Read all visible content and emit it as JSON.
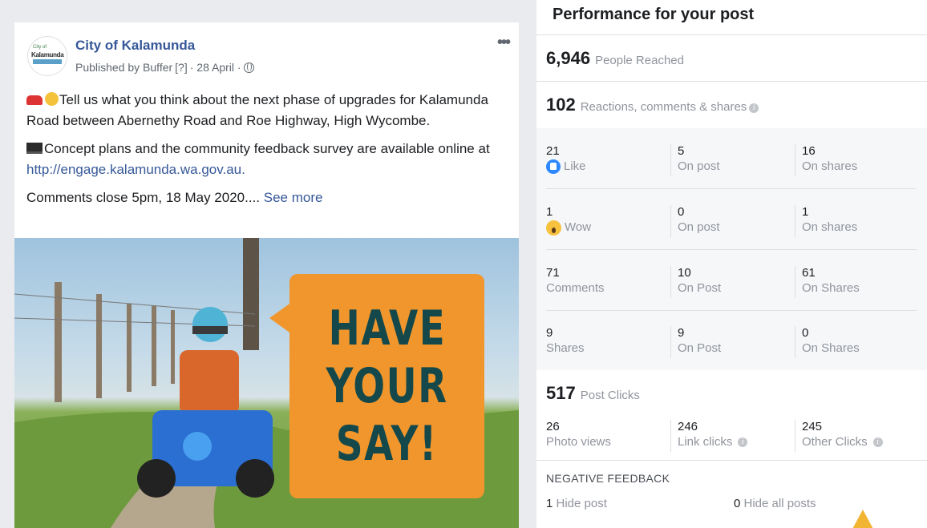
{
  "post": {
    "page_name": "City of Kalamunda",
    "avatar_text": {
      "top": "City of",
      "main": "Kalamunda",
      "band": ""
    },
    "published_by": "Published by Buffer",
    "bracket": "[?]",
    "date": "· 28 April ·",
    "more": "•••",
    "paragraph1": "Tell us what you think about the next phase of upgrades for Kalamunda Road between Abernethy Road and Roe Highway, High Wycombe.",
    "paragraph2_text": "Concept plans and the community feedback survey are available online at ",
    "paragraph2_link": "http://engage.kalamunda.wa.gov.au.",
    "paragraph3_text": "Comments close 5pm, 18 May 2020.... ",
    "see_more": "See more",
    "image_text": [
      "HAVE",
      "YOUR",
      "SAY!"
    ]
  },
  "panel": {
    "title": "Performance for your post",
    "reached": {
      "value": "6,946",
      "label": "People Reached"
    },
    "engagement": {
      "value": "102",
      "label": "Reactions, comments & shares"
    },
    "rows": [
      [
        {
          "n": "21",
          "l": "Like",
          "icon": "like-icon"
        },
        {
          "n": "5",
          "l": "On post"
        },
        {
          "n": "16",
          "l": "On shares"
        }
      ],
      [
        {
          "n": "1",
          "l": "Wow",
          "icon": "wow-icon"
        },
        {
          "n": "0",
          "l": "On post"
        },
        {
          "n": "1",
          "l": "On shares"
        }
      ],
      [
        {
          "n": "71",
          "l": "Comments"
        },
        {
          "n": "10",
          "l": "On Post"
        },
        {
          "n": "61",
          "l": "On Shares"
        }
      ],
      [
        {
          "n": "9",
          "l": "Shares"
        },
        {
          "n": "9",
          "l": "On Post"
        },
        {
          "n": "0",
          "l": "On Shares"
        }
      ]
    ],
    "clicks": {
      "value": "517",
      "label": "Post Clicks"
    },
    "click_rows": [
      {
        "n": "26",
        "l": "Photo views"
      },
      {
        "n": "246",
        "l": "Link clicks"
      },
      {
        "n": "245",
        "l": "Other Clicks"
      }
    ],
    "negative_title": "NEGATIVE FEEDBACK",
    "hide_post": {
      "n": "1",
      "l": "Hide post"
    },
    "hide_all": {
      "n": "0",
      "l": "Hide all posts"
    }
  },
  "colors": {
    "link": "#365899",
    "accent_orange": "#f0962c",
    "bubble_text": "#14484b"
  }
}
